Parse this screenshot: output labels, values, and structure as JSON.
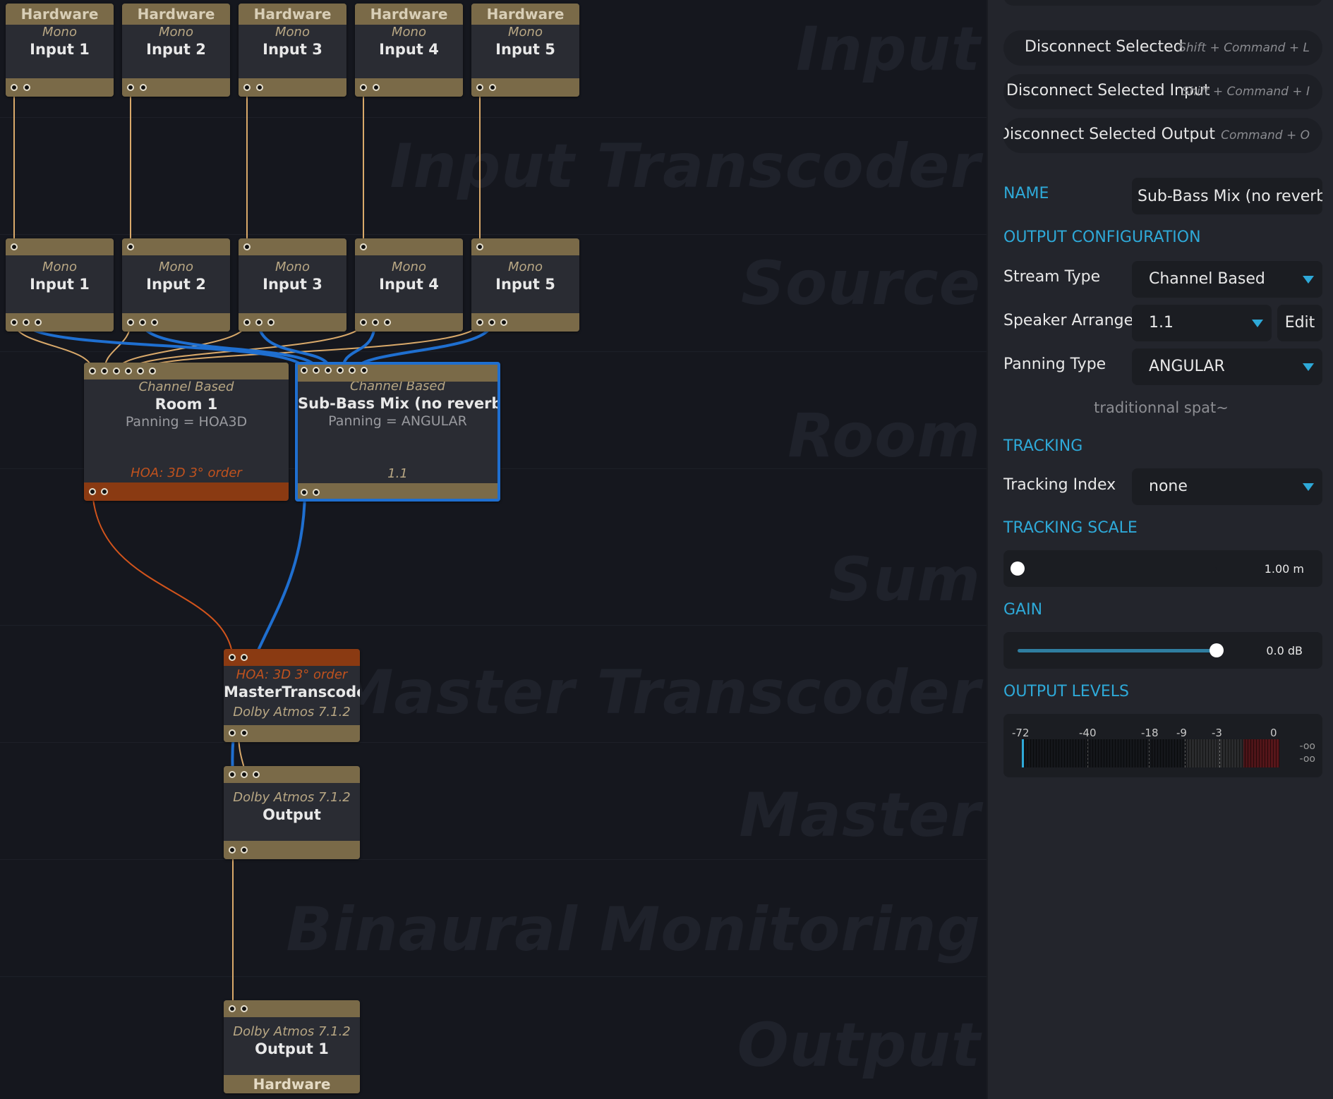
{
  "canvas": {
    "bands": [
      "Input",
      "Input Transcoder",
      "Source",
      "Room",
      "Sum",
      "Master Transcoder",
      "Master",
      "Binaural Monitoring",
      "Output"
    ],
    "hardware_inputs": [
      {
        "header": "Hardware",
        "format": "Mono",
        "name": "Input 1"
      },
      {
        "header": "Hardware",
        "format": "Mono",
        "name": "Input 2"
      },
      {
        "header": "Hardware",
        "format": "Mono",
        "name": "Input 3"
      },
      {
        "header": "Hardware",
        "format": "Mono",
        "name": "Input 4"
      },
      {
        "header": "Hardware",
        "format": "Mono",
        "name": "Input 5"
      }
    ],
    "sources": [
      {
        "format": "Mono",
        "name": "Input 1"
      },
      {
        "format": "Mono",
        "name": "Input 2"
      },
      {
        "format": "Mono",
        "name": "Input 3"
      },
      {
        "format": "Mono",
        "name": "Input 4"
      },
      {
        "format": "Mono",
        "name": "Input 5"
      }
    ],
    "room1": {
      "type": "Channel Based",
      "name": "Room 1",
      "panning": "Panning = HOA3D",
      "format": "HOA: 3D 3° order"
    },
    "room2": {
      "type": "Channel Based",
      "name": "Sub-Bass Mix (no reverb)",
      "panning": "Panning = ANGULAR",
      "format": "1.1"
    },
    "master_transcoder": {
      "input_format": "HOA: 3D 3° order",
      "name": "MasterTranscoder",
      "output_format": "Dolby Atmos 7.1.2"
    },
    "master": {
      "format": "Dolby Atmos 7.1.2",
      "name": "Output"
    },
    "output": {
      "format": "Dolby Atmos 7.1.2",
      "name": "Output 1",
      "footer": "Hardware"
    },
    "colors": {
      "hw": "#7a6a48",
      "orange": "#8a3a12",
      "blue_wire": "#1f6fd0",
      "tan_wire": "#d9a96a",
      "orange_wire": "#d2541c"
    }
  },
  "panel": {
    "buttons": [
      {
        "label": "Disconnect Selected",
        "shortcut": "Shift + Command + L"
      },
      {
        "label": "Disconnect Selected Input",
        "shortcut": "Shift + Command + I"
      },
      {
        "label": "Disconnect Selected Output",
        "shortcut": "Shift + Command + O"
      }
    ],
    "name_section": "NAME",
    "name_value": "Sub-Bass Mix (no reverb)",
    "output_config_section": "OUTPUT CONFIGURATION",
    "stream_type_label": "Stream Type",
    "stream_type_value": "Channel Based",
    "speaker_arrangement_label": "Speaker Arrangement",
    "speaker_arrangement_value": "1.1",
    "edit_label": "Edit",
    "panning_type_label": "Panning Type",
    "panning_type_value": "ANGULAR",
    "panning_hint": "traditionnal spat~",
    "tracking_section": "TRACKING",
    "tracking_index_label": "Tracking Index",
    "tracking_index_value": "none",
    "tracking_scale_section": "TRACKING SCALE",
    "tracking_scale_value": "1.00 m",
    "tracking_scale_fraction": 0.0,
    "gain_section": "GAIN",
    "gain_value": "0.0 dB",
    "gain_fraction": 1.0,
    "output_levels_section": "OUTPUT LEVELS",
    "meter_ticks": [
      "-72",
      "-40",
      "-18",
      "-9",
      "-3",
      "0"
    ],
    "meter_readouts": [
      "-oo",
      "-oo"
    ],
    "accent": "#2ea9d8"
  }
}
